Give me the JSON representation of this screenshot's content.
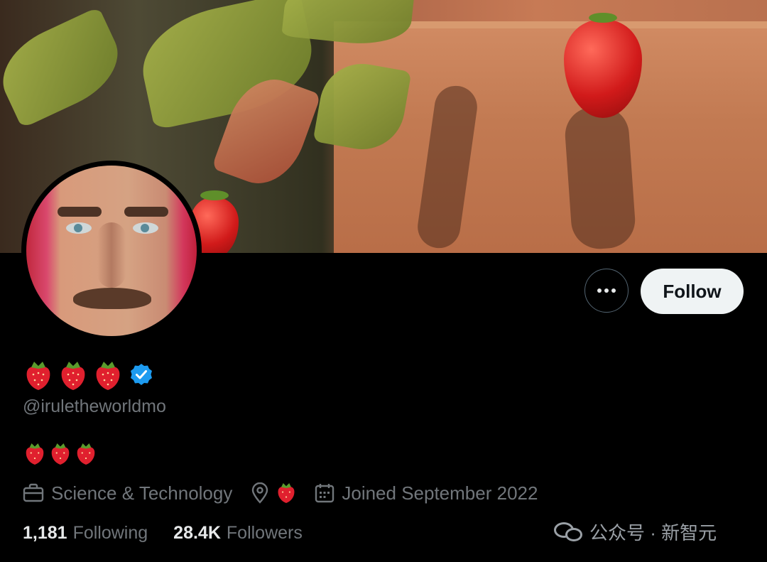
{
  "profile": {
    "display_name_emoji": "🍓🍓🍓",
    "handle": "@iruletheworldmo",
    "bio_emoji": "🍓🍓🍓",
    "verified": true
  },
  "actions": {
    "more_icon": "more-horizontal-icon",
    "follow_label": "Follow"
  },
  "meta": {
    "category": "Science & Technology",
    "location_emoji": "🍓",
    "joined": "Joined September 2022"
  },
  "stats": {
    "following_count": "1,181",
    "following_label": "Following",
    "followers_count": "28.4K",
    "followers_label": "Followers"
  },
  "watermark": {
    "text": "公众号 · 新智元"
  },
  "colors": {
    "background": "#000000",
    "text_primary": "#e7e9ea",
    "text_secondary": "#71767b",
    "verified_badge": "#1d9bf0",
    "follow_button_bg": "#eff3f4"
  }
}
